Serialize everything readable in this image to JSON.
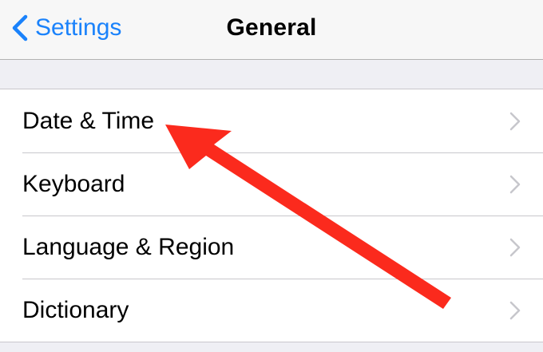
{
  "nav": {
    "back_label": "Settings",
    "title": "General"
  },
  "list": {
    "items": [
      {
        "label": "Date & Time"
      },
      {
        "label": "Keyboard"
      },
      {
        "label": "Language & Region"
      },
      {
        "label": "Dictionary"
      }
    ]
  },
  "colors": {
    "accent": "#1a82fb",
    "background": "#efeff4",
    "annotation": "#fb2a1d",
    "chevron": "#c7c7cc"
  },
  "icons": {
    "back": "chevron-left-icon",
    "disclosure": "chevron-right-icon"
  }
}
